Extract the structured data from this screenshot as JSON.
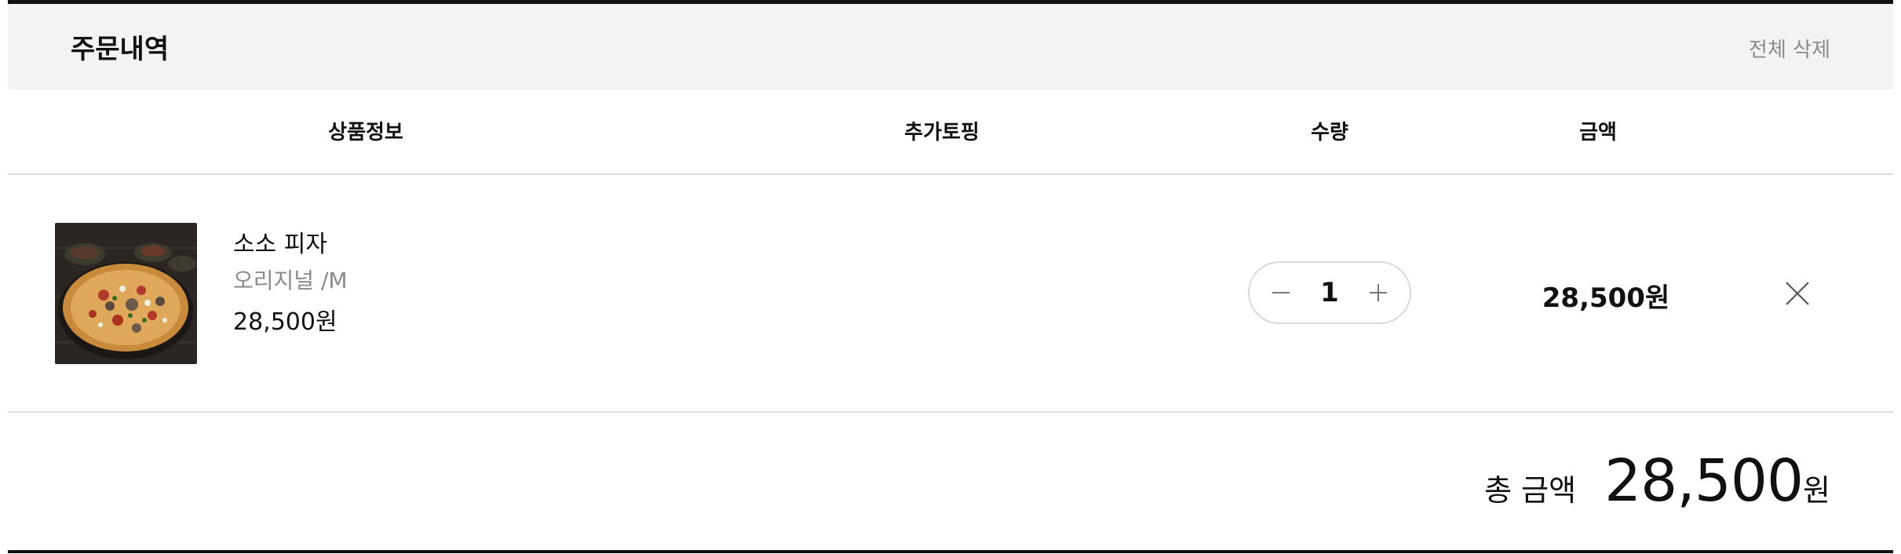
{
  "header": {
    "title": "주문내역",
    "delete_all": "전체 삭제"
  },
  "columns": {
    "product": "상품정보",
    "topping": "추가토핑",
    "quantity": "수량",
    "amount": "금액"
  },
  "item": {
    "name": "소소 피자",
    "option": "오리지널 /M",
    "price": "28,500원",
    "quantity": "1",
    "amount": "28,500원",
    "image": "pizza-photo"
  },
  "icons": {
    "decrease": "minus-icon",
    "increase": "plus-icon",
    "remove": "close-icon"
  },
  "total": {
    "label": "총 금액",
    "value": "28,500",
    "unit": "원"
  }
}
